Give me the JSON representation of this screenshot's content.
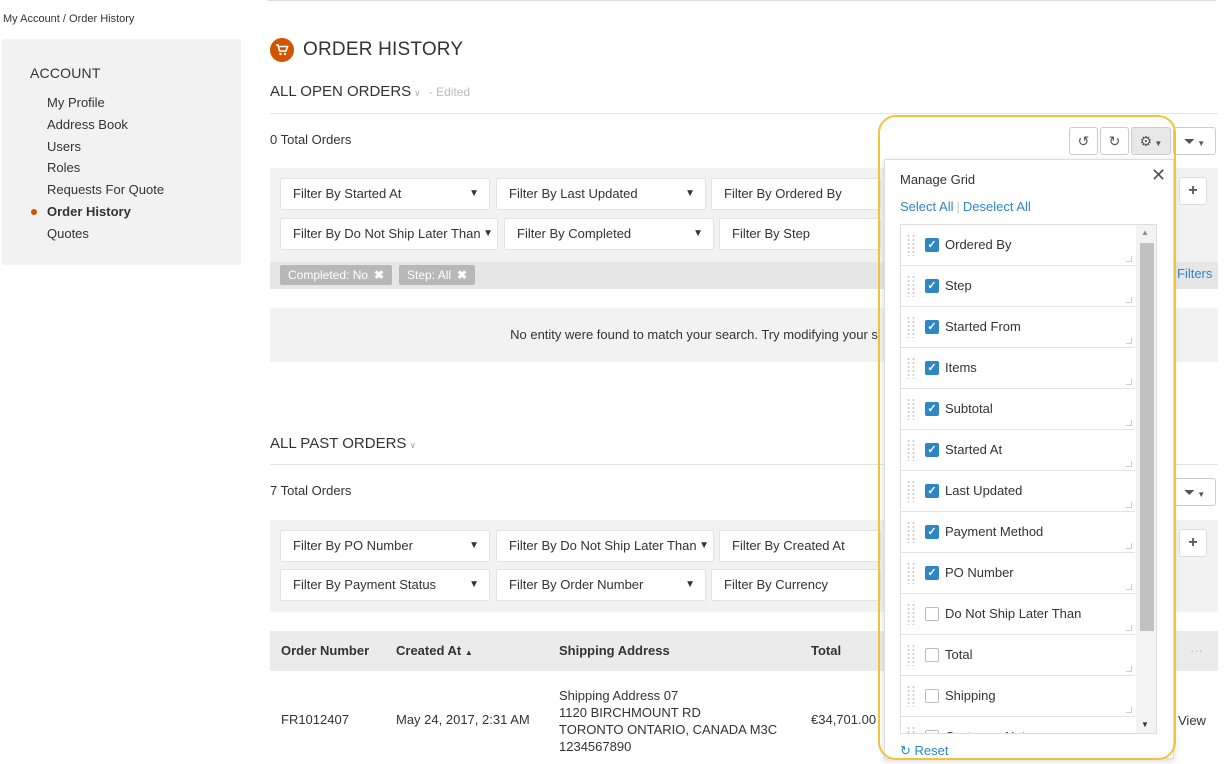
{
  "breadcrumb": "My Account / Order History",
  "sidebar": {
    "heading": "ACCOUNT",
    "items": [
      {
        "label": "My Profile"
      },
      {
        "label": "Address Book"
      },
      {
        "label": "Users"
      },
      {
        "label": "Roles"
      },
      {
        "label": "Requests For Quote"
      },
      {
        "label": "Order History",
        "active": true
      },
      {
        "label": "Quotes"
      }
    ]
  },
  "page": {
    "title": "ORDER HISTORY",
    "title_icon": "cart-icon",
    "accent_color": "#d35400"
  },
  "open_orders": {
    "title": "ALL OPEN ORDERS",
    "edited": "- Edited",
    "total": "0 Total Orders",
    "filters": [
      "Filter By Started At",
      "Filter By Last Updated",
      "Filter By Ordered By",
      "Filter By Do Not Ship Later Than",
      "Filter By Completed",
      "Filter By Step"
    ],
    "chips": [
      "Completed: No",
      "Step: All"
    ],
    "filters_link": "Filters",
    "empty_message": "No entity were found to match your search. Try modifying your s"
  },
  "past_orders": {
    "title": "ALL PAST ORDERS",
    "total": "7 Total Orders",
    "filters": [
      "Filter By PO Number",
      "Filter By Do Not Ship Later Than",
      "Filter By Created At",
      "Filter By Payment Status",
      "Filter By Order Number",
      "Filter By Currency"
    ],
    "columns": [
      "Order Number",
      "Created At",
      "Shipping Address",
      "Total"
    ],
    "sort_indicator": "▲",
    "more": "···",
    "rows": [
      {
        "order_number": "FR1012407",
        "created_at": "May 24, 2017, 2:31 AM",
        "address": [
          "Shipping Address 07",
          "1120 BIRCHMOUNT RD",
          "TORONTO ONTARIO, CANADA M3C",
          "1234567890"
        ],
        "total": "€34,701.00",
        "action": "View"
      }
    ]
  },
  "manage_grid": {
    "title": "Manage Grid",
    "select_all": "Select All",
    "deselect_all": "Deselect All",
    "reset": "Reset",
    "columns": [
      {
        "label": "Ordered By",
        "checked": true
      },
      {
        "label": "Step",
        "checked": true
      },
      {
        "label": "Started From",
        "checked": true
      },
      {
        "label": "Items",
        "checked": true
      },
      {
        "label": "Subtotal",
        "checked": true
      },
      {
        "label": "Started At",
        "checked": true
      },
      {
        "label": "Last Updated",
        "checked": true
      },
      {
        "label": "Payment Method",
        "checked": true
      },
      {
        "label": "PO Number",
        "checked": true
      },
      {
        "label": "Do Not Ship Later Than",
        "checked": false
      },
      {
        "label": "Total",
        "checked": false
      },
      {
        "label": "Shipping",
        "checked": false
      },
      {
        "label": "Customer Notes",
        "checked": false
      }
    ]
  },
  "colors": {
    "link": "#2f86c5",
    "highlight": "#f0c33c",
    "checkbox": "#2f86c5"
  }
}
